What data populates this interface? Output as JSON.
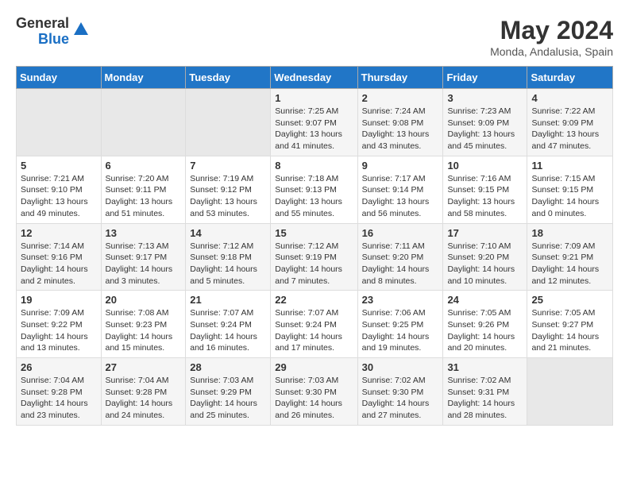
{
  "header": {
    "logo_general": "General",
    "logo_blue": "Blue",
    "month_year": "May 2024",
    "location": "Monda, Andalusia, Spain"
  },
  "days_of_week": [
    "Sunday",
    "Monday",
    "Tuesday",
    "Wednesday",
    "Thursday",
    "Friday",
    "Saturday"
  ],
  "weeks": [
    [
      {
        "day": "",
        "content": ""
      },
      {
        "day": "",
        "content": ""
      },
      {
        "day": "",
        "content": ""
      },
      {
        "day": "1",
        "content": "Sunrise: 7:25 AM\nSunset: 9:07 PM\nDaylight: 13 hours and 41 minutes."
      },
      {
        "day": "2",
        "content": "Sunrise: 7:24 AM\nSunset: 9:08 PM\nDaylight: 13 hours and 43 minutes."
      },
      {
        "day": "3",
        "content": "Sunrise: 7:23 AM\nSunset: 9:09 PM\nDaylight: 13 hours and 45 minutes."
      },
      {
        "day": "4",
        "content": "Sunrise: 7:22 AM\nSunset: 9:09 PM\nDaylight: 13 hours and 47 minutes."
      }
    ],
    [
      {
        "day": "5",
        "content": "Sunrise: 7:21 AM\nSunset: 9:10 PM\nDaylight: 13 hours and 49 minutes."
      },
      {
        "day": "6",
        "content": "Sunrise: 7:20 AM\nSunset: 9:11 PM\nDaylight: 13 hours and 51 minutes."
      },
      {
        "day": "7",
        "content": "Sunrise: 7:19 AM\nSunset: 9:12 PM\nDaylight: 13 hours and 53 minutes."
      },
      {
        "day": "8",
        "content": "Sunrise: 7:18 AM\nSunset: 9:13 PM\nDaylight: 13 hours and 55 minutes."
      },
      {
        "day": "9",
        "content": "Sunrise: 7:17 AM\nSunset: 9:14 PM\nDaylight: 13 hours and 56 minutes."
      },
      {
        "day": "10",
        "content": "Sunrise: 7:16 AM\nSunset: 9:15 PM\nDaylight: 13 hours and 58 minutes."
      },
      {
        "day": "11",
        "content": "Sunrise: 7:15 AM\nSunset: 9:15 PM\nDaylight: 14 hours and 0 minutes."
      }
    ],
    [
      {
        "day": "12",
        "content": "Sunrise: 7:14 AM\nSunset: 9:16 PM\nDaylight: 14 hours and 2 minutes."
      },
      {
        "day": "13",
        "content": "Sunrise: 7:13 AM\nSunset: 9:17 PM\nDaylight: 14 hours and 3 minutes."
      },
      {
        "day": "14",
        "content": "Sunrise: 7:12 AM\nSunset: 9:18 PM\nDaylight: 14 hours and 5 minutes."
      },
      {
        "day": "15",
        "content": "Sunrise: 7:12 AM\nSunset: 9:19 PM\nDaylight: 14 hours and 7 minutes."
      },
      {
        "day": "16",
        "content": "Sunrise: 7:11 AM\nSunset: 9:20 PM\nDaylight: 14 hours and 8 minutes."
      },
      {
        "day": "17",
        "content": "Sunrise: 7:10 AM\nSunset: 9:20 PM\nDaylight: 14 hours and 10 minutes."
      },
      {
        "day": "18",
        "content": "Sunrise: 7:09 AM\nSunset: 9:21 PM\nDaylight: 14 hours and 12 minutes."
      }
    ],
    [
      {
        "day": "19",
        "content": "Sunrise: 7:09 AM\nSunset: 9:22 PM\nDaylight: 14 hours and 13 minutes."
      },
      {
        "day": "20",
        "content": "Sunrise: 7:08 AM\nSunset: 9:23 PM\nDaylight: 14 hours and 15 minutes."
      },
      {
        "day": "21",
        "content": "Sunrise: 7:07 AM\nSunset: 9:24 PM\nDaylight: 14 hours and 16 minutes."
      },
      {
        "day": "22",
        "content": "Sunrise: 7:07 AM\nSunset: 9:24 PM\nDaylight: 14 hours and 17 minutes."
      },
      {
        "day": "23",
        "content": "Sunrise: 7:06 AM\nSunset: 9:25 PM\nDaylight: 14 hours and 19 minutes."
      },
      {
        "day": "24",
        "content": "Sunrise: 7:05 AM\nSunset: 9:26 PM\nDaylight: 14 hours and 20 minutes."
      },
      {
        "day": "25",
        "content": "Sunrise: 7:05 AM\nSunset: 9:27 PM\nDaylight: 14 hours and 21 minutes."
      }
    ],
    [
      {
        "day": "26",
        "content": "Sunrise: 7:04 AM\nSunset: 9:28 PM\nDaylight: 14 hours and 23 minutes."
      },
      {
        "day": "27",
        "content": "Sunrise: 7:04 AM\nSunset: 9:28 PM\nDaylight: 14 hours and 24 minutes."
      },
      {
        "day": "28",
        "content": "Sunrise: 7:03 AM\nSunset: 9:29 PM\nDaylight: 14 hours and 25 minutes."
      },
      {
        "day": "29",
        "content": "Sunrise: 7:03 AM\nSunset: 9:30 PM\nDaylight: 14 hours and 26 minutes."
      },
      {
        "day": "30",
        "content": "Sunrise: 7:02 AM\nSunset: 9:30 PM\nDaylight: 14 hours and 27 minutes."
      },
      {
        "day": "31",
        "content": "Sunrise: 7:02 AM\nSunset: 9:31 PM\nDaylight: 14 hours and 28 minutes."
      },
      {
        "day": "",
        "content": ""
      }
    ]
  ]
}
